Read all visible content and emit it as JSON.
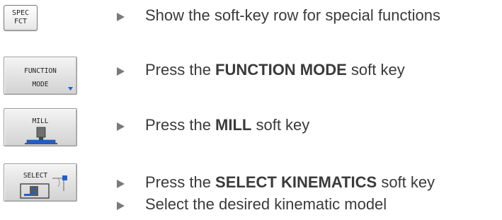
{
  "steps": [
    {
      "key_label_line1": "SPEC",
      "key_label_line2": "FCT",
      "instruction": "Show the soft-key row for special functions"
    },
    {
      "key_label_line1": "FUNCTION",
      "key_label_line2": "MODE",
      "instruction_prefix": "Press the ",
      "instruction_bold": "FUNCTION MODE",
      "instruction_suffix": " soft key"
    },
    {
      "key_label_line1": "MILL",
      "instruction_prefix": "Press the ",
      "instruction_bold": "MILL",
      "instruction_suffix": " soft key"
    },
    {
      "key_label_line1": "SELECT",
      "instruction_prefix": "Press the ",
      "instruction_bold": "SELECT KINEMATICS",
      "instruction_suffix": " soft key"
    }
  ],
  "extra_instruction": "Select the desired kinematic model",
  "colors": {
    "accent": "#1e5fd0",
    "bullet": "#7a7a7a",
    "text": "#3a3a3a"
  },
  "icons": [
    "triangle-bullet-icon",
    "mill-machine-icon",
    "select-kinematics-icon",
    "dropdown-indicator-icon"
  ]
}
